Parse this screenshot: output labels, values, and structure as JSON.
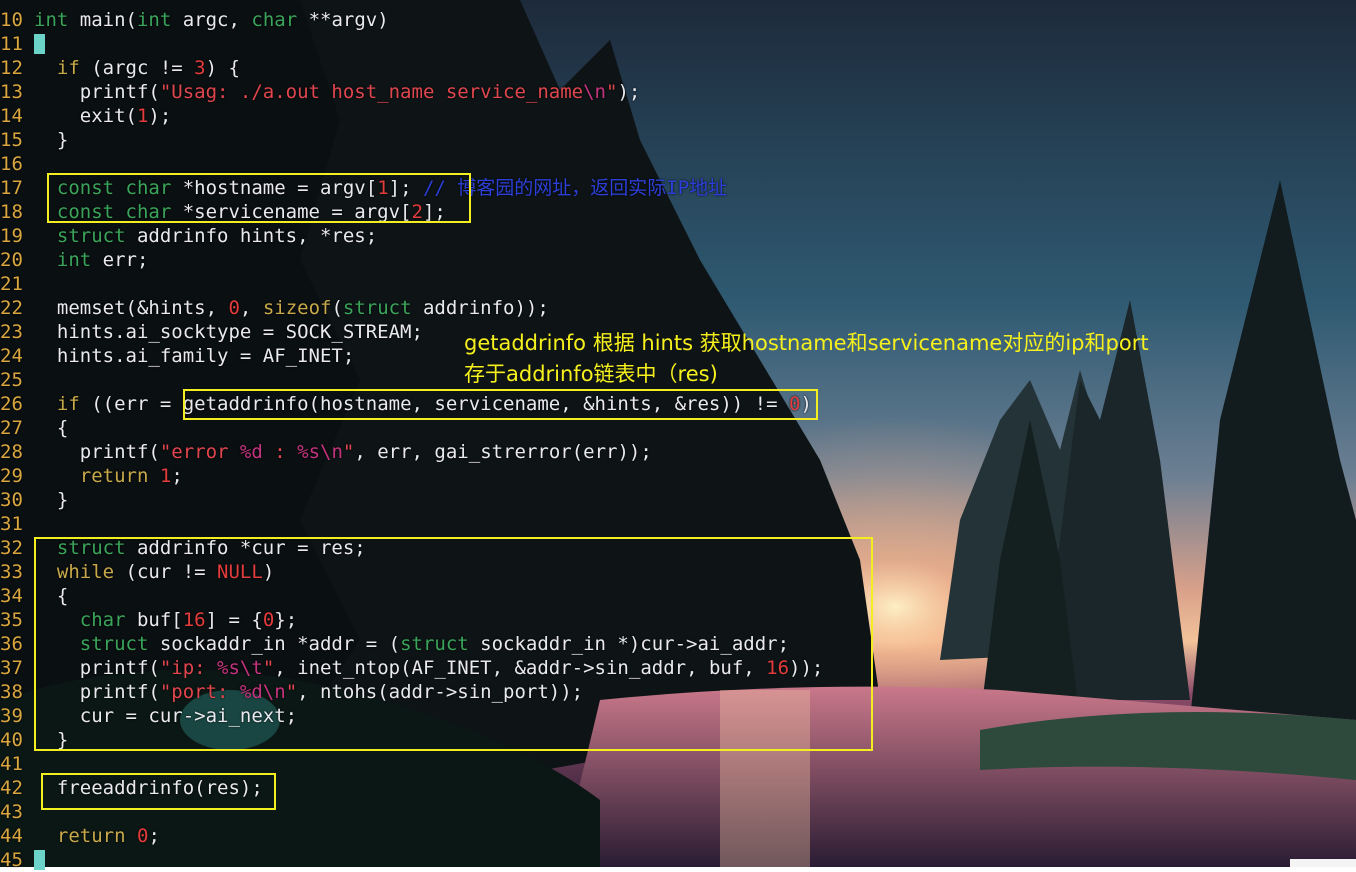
{
  "editor": {
    "lines": [
      {
        "n": "10",
        "tokens": [
          [
            "kw",
            "int"
          ],
          [
            "fn",
            " main("
          ],
          [
            "kw",
            "int"
          ],
          [
            "fn",
            " argc, "
          ],
          [
            "kw",
            "char"
          ],
          [
            "fn",
            " **argv)"
          ]
        ]
      },
      {
        "n": "11",
        "tokens": [
          [
            "cursor",
            ""
          ]
        ]
      },
      {
        "n": "12",
        "tokens": [
          [
            "fn",
            "  "
          ],
          [
            "ctl",
            "if"
          ],
          [
            "fn",
            " (argc != "
          ],
          [
            "num",
            "3"
          ],
          [
            "fn",
            ") {"
          ]
        ]
      },
      {
        "n": "13",
        "tokens": [
          [
            "fn",
            "    printf("
          ],
          [
            "str",
            "\"Usag: ./a.out host_name service_name"
          ],
          [
            "esc",
            "\\n"
          ],
          [
            "str",
            "\""
          ],
          [
            "fn",
            ");"
          ]
        ]
      },
      {
        "n": "14",
        "tokens": [
          [
            "fn",
            "    exit("
          ],
          [
            "num",
            "1"
          ],
          [
            "fn",
            ");"
          ]
        ]
      },
      {
        "n": "15",
        "tokens": [
          [
            "fn",
            "  }"
          ]
        ]
      },
      {
        "n": "16",
        "tokens": []
      },
      {
        "n": "17",
        "tokens": [
          [
            "fn",
            "  "
          ],
          [
            "kw",
            "const char"
          ],
          [
            "fn",
            " *hostname = argv["
          ],
          [
            "num",
            "1"
          ],
          [
            "fn",
            "]; "
          ],
          [
            "cmt",
            "// 博客园的网址，返回实际IP地址"
          ]
        ]
      },
      {
        "n": "18",
        "tokens": [
          [
            "fn",
            "  "
          ],
          [
            "kw",
            "const char"
          ],
          [
            "fn",
            " *servicename = argv["
          ],
          [
            "num",
            "2"
          ],
          [
            "fn",
            "];"
          ]
        ]
      },
      {
        "n": "19",
        "tokens": [
          [
            "fn",
            "  "
          ],
          [
            "kw",
            "struct"
          ],
          [
            "fn",
            " addrinfo hints, *res;"
          ]
        ]
      },
      {
        "n": "20",
        "tokens": [
          [
            "fn",
            "  "
          ],
          [
            "kw",
            "int"
          ],
          [
            "fn",
            " err;"
          ]
        ]
      },
      {
        "n": "21",
        "tokens": []
      },
      {
        "n": "22",
        "tokens": [
          [
            "fn",
            "  memset(&hints, "
          ],
          [
            "num",
            "0"
          ],
          [
            "fn",
            ", "
          ],
          [
            "ctl",
            "sizeof"
          ],
          [
            "fn",
            "("
          ],
          [
            "kw",
            "struct"
          ],
          [
            "fn",
            " addrinfo));"
          ]
        ]
      },
      {
        "n": "23",
        "tokens": [
          [
            "fn",
            "  hints.ai_socktype = SOCK_STREAM;"
          ]
        ]
      },
      {
        "n": "24",
        "tokens": [
          [
            "fn",
            "  hints.ai_family = AF_INET;"
          ]
        ]
      },
      {
        "n": "25",
        "tokens": []
      },
      {
        "n": "26",
        "tokens": [
          [
            "fn",
            "  "
          ],
          [
            "ctl",
            "if"
          ],
          [
            "fn",
            " ((err = getaddrinfo(hostname, servicename, &hints, &res)) != "
          ],
          [
            "num",
            "0"
          ],
          [
            "fn",
            ")"
          ]
        ]
      },
      {
        "n": "27",
        "tokens": [
          [
            "fn",
            "  {"
          ]
        ]
      },
      {
        "n": "28",
        "tokens": [
          [
            "fn",
            "    printf("
          ],
          [
            "str",
            "\"error "
          ],
          [
            "esc",
            "%d"
          ],
          [
            "str",
            " : "
          ],
          [
            "esc",
            "%s\\n"
          ],
          [
            "str",
            "\""
          ],
          [
            "fn",
            ", err, gai_strerror(err));"
          ]
        ]
      },
      {
        "n": "29",
        "tokens": [
          [
            "fn",
            "    "
          ],
          [
            "ctl",
            "return"
          ],
          [
            "fn",
            " "
          ],
          [
            "num",
            "1"
          ],
          [
            "fn",
            ";"
          ]
        ]
      },
      {
        "n": "30",
        "tokens": [
          [
            "fn",
            "  }"
          ]
        ]
      },
      {
        "n": "31",
        "tokens": []
      },
      {
        "n": "32",
        "tokens": [
          [
            "fn",
            "  "
          ],
          [
            "kw",
            "struct"
          ],
          [
            "fn",
            " addrinfo *cur = res;"
          ]
        ]
      },
      {
        "n": "33",
        "tokens": [
          [
            "fn",
            "  "
          ],
          [
            "ctl",
            "while"
          ],
          [
            "fn",
            " (cur != "
          ],
          [
            "num",
            "NULL"
          ],
          [
            "fn",
            ")"
          ]
        ]
      },
      {
        "n": "34",
        "tokens": [
          [
            "fn",
            "  {"
          ]
        ]
      },
      {
        "n": "35",
        "tokens": [
          [
            "fn",
            "    "
          ],
          [
            "kw",
            "char"
          ],
          [
            "fn",
            " buf["
          ],
          [
            "num",
            "16"
          ],
          [
            "fn",
            "] = {"
          ],
          [
            "num",
            "0"
          ],
          [
            "fn",
            "};"
          ]
        ]
      },
      {
        "n": "36",
        "tokens": [
          [
            "fn",
            "    "
          ],
          [
            "kw",
            "struct"
          ],
          [
            "fn",
            " sockaddr_in *addr = ("
          ],
          [
            "kw",
            "struct"
          ],
          [
            "fn",
            " sockaddr_in *)cur->ai_addr;"
          ]
        ]
      },
      {
        "n": "37",
        "tokens": [
          [
            "fn",
            "    printf("
          ],
          [
            "str",
            "\"ip: "
          ],
          [
            "esc",
            "%s\\t"
          ],
          [
            "str",
            "\""
          ],
          [
            "fn",
            ", inet_ntop(AF_INET, &addr->sin_addr, buf, "
          ],
          [
            "num",
            "16"
          ],
          [
            "fn",
            "));"
          ]
        ]
      },
      {
        "n": "38",
        "tokens": [
          [
            "fn",
            "    printf("
          ],
          [
            "str",
            "\"port: "
          ],
          [
            "esc",
            "%d\\n"
          ],
          [
            "str",
            "\""
          ],
          [
            "fn",
            ", ntohs(addr->sin_port));"
          ]
        ]
      },
      {
        "n": "39",
        "tokens": [
          [
            "fn",
            "    cur = cur->ai_next;"
          ]
        ]
      },
      {
        "n": "40",
        "tokens": [
          [
            "fn",
            "  }"
          ]
        ]
      },
      {
        "n": "41",
        "tokens": []
      },
      {
        "n": "42",
        "tokens": [
          [
            "fn",
            "  freeaddrinfo(res);"
          ]
        ]
      },
      {
        "n": "43",
        "tokens": []
      },
      {
        "n": "44",
        "tokens": [
          [
            "fn",
            "  "
          ],
          [
            "ctl",
            "return"
          ],
          [
            "fn",
            " "
          ],
          [
            "num",
            "0"
          ],
          [
            "fn",
            ";"
          ]
        ]
      },
      {
        "n": "45",
        "tokens": [
          [
            "cursor",
            ""
          ]
        ]
      }
    ]
  },
  "annotation": {
    "line1": "getaddrinfo 根据 hints 获取hostname和servicename对应的ip和port",
    "line2": "存于addrinfo链表中（res)"
  },
  "colors": {
    "highlight_box": "#f2ee1f",
    "annotation_text": "#f6f01c",
    "line_number": "#d9a640",
    "keyword": "#3aa55a",
    "string": "#e0464e",
    "comment": "#2c3fd8"
  }
}
